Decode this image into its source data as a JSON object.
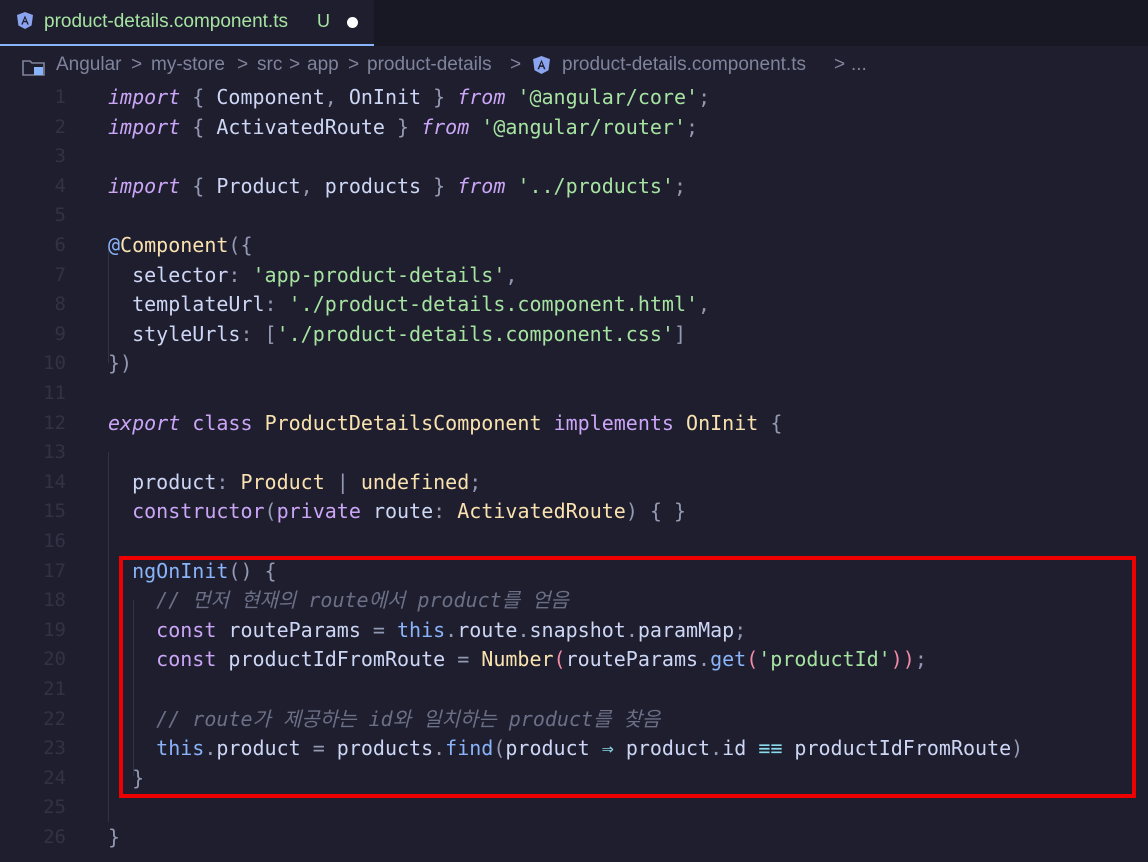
{
  "tab": {
    "title": "product-details.component.ts",
    "status": "U"
  },
  "breadcrumb": {
    "items": [
      "Angular",
      "my-store",
      "src",
      "app",
      "product-details",
      "product-details.component.ts",
      "..."
    ],
    "separator": ">"
  },
  "editor": {
    "lines": [
      {
        "n": "1",
        "tokens": [
          [
            "kw",
            "import"
          ],
          [
            "pu",
            " { "
          ],
          [
            "prop",
            "Component"
          ],
          [
            "pu",
            ", "
          ],
          [
            "prop",
            "OnInit"
          ],
          [
            "pu",
            " } "
          ],
          [
            "kw",
            "from"
          ],
          [
            "pu",
            " "
          ],
          [
            "str",
            "'@angular/core'"
          ],
          [
            "pu",
            ";"
          ]
        ]
      },
      {
        "n": "2",
        "tokens": [
          [
            "kw",
            "import"
          ],
          [
            "pu",
            " { "
          ],
          [
            "prop",
            "ActivatedRoute"
          ],
          [
            "pu",
            " } "
          ],
          [
            "kw",
            "from"
          ],
          [
            "pu",
            " "
          ],
          [
            "str",
            "'@angular/router'"
          ],
          [
            "pu",
            ";"
          ]
        ]
      },
      {
        "n": "3",
        "tokens": []
      },
      {
        "n": "4",
        "tokens": [
          [
            "kw",
            "import"
          ],
          [
            "pu",
            " { "
          ],
          [
            "prop",
            "Product"
          ],
          [
            "pu",
            ", "
          ],
          [
            "prop",
            "products"
          ],
          [
            "pu",
            " } "
          ],
          [
            "kw",
            "from"
          ],
          [
            "pu",
            " "
          ],
          [
            "str",
            "'../products'"
          ],
          [
            "pu",
            ";"
          ]
        ]
      },
      {
        "n": "5",
        "tokens": []
      },
      {
        "n": "6",
        "tokens": [
          [
            "dec",
            "@"
          ],
          [
            "ty",
            "Component"
          ],
          [
            "pu",
            "({"
          ]
        ]
      },
      {
        "n": "7",
        "tokens": [
          [
            "prop",
            "  selector"
          ],
          [
            "pu",
            ": "
          ],
          [
            "str",
            "'app-product-details'"
          ],
          [
            "pu",
            ","
          ]
        ]
      },
      {
        "n": "8",
        "tokens": [
          [
            "prop",
            "  templateUrl"
          ],
          [
            "pu",
            ": "
          ],
          [
            "str",
            "'./product-details.component.html'"
          ],
          [
            "pu",
            ","
          ]
        ]
      },
      {
        "n": "9",
        "tokens": [
          [
            "prop",
            "  styleUrls"
          ],
          [
            "pu",
            ": ["
          ],
          [
            "str",
            "'./product-details.component.css'"
          ],
          [
            "pu",
            "]"
          ]
        ]
      },
      {
        "n": "10",
        "tokens": [
          [
            "pu",
            "})"
          ]
        ]
      },
      {
        "n": "11",
        "tokens": []
      },
      {
        "n": "12",
        "tokens": [
          [
            "kw",
            "export"
          ],
          [
            "pu",
            " "
          ],
          [
            "kwn",
            "class"
          ],
          [
            "pu",
            " "
          ],
          [
            "ty",
            "ProductDetailsComponent"
          ],
          [
            "pu",
            " "
          ],
          [
            "kwn",
            "implements"
          ],
          [
            "pu",
            " "
          ],
          [
            "ty",
            "OnInit"
          ],
          [
            "pu",
            " {"
          ]
        ]
      },
      {
        "n": "13",
        "tokens": []
      },
      {
        "n": "14",
        "tokens": [
          [
            "prop",
            "  product"
          ],
          [
            "pu",
            ": "
          ],
          [
            "ty",
            "Product"
          ],
          [
            "pu",
            " | "
          ],
          [
            "ty",
            "undefined"
          ],
          [
            "pu",
            ";"
          ]
        ]
      },
      {
        "n": "15",
        "tokens": [
          [
            "kwn",
            "  constructor"
          ],
          [
            "pu",
            "("
          ],
          [
            "kwn",
            "private"
          ],
          [
            "pu",
            " "
          ],
          [
            "prop",
            "route"
          ],
          [
            "pu",
            ": "
          ],
          [
            "ty",
            "ActivatedRoute"
          ],
          [
            "pu",
            ") { }"
          ]
        ]
      },
      {
        "n": "16",
        "tokens": []
      },
      {
        "n": "17",
        "tokens": [
          [
            "fn",
            "  ngOnInit"
          ],
          [
            "pu",
            "() {"
          ]
        ]
      },
      {
        "n": "18",
        "tokens": [
          [
            "cm",
            "    // 먼저 현재의 route에서 product를 얻음"
          ]
        ]
      },
      {
        "n": "19",
        "tokens": [
          [
            "kwn",
            "    const"
          ],
          [
            "pu",
            " "
          ],
          [
            "prop",
            "routeParams"
          ],
          [
            "pu",
            " = "
          ],
          [
            "this",
            "this"
          ],
          [
            "pu",
            "."
          ],
          [
            "prop",
            "route"
          ],
          [
            "pu",
            "."
          ],
          [
            "prop",
            "snapshot"
          ],
          [
            "pu",
            "."
          ],
          [
            "prop",
            "paramMap"
          ],
          [
            "pu",
            ";"
          ]
        ]
      },
      {
        "n": "20",
        "tokens": [
          [
            "kwn",
            "    const"
          ],
          [
            "pu",
            " "
          ],
          [
            "prop",
            "productIdFromRoute"
          ],
          [
            "pu",
            " = "
          ],
          [
            "ty",
            "Number"
          ],
          [
            "br",
            "("
          ],
          [
            "prop",
            "routeParams"
          ],
          [
            "pu",
            "."
          ],
          [
            "fn",
            "get"
          ],
          [
            "br",
            "("
          ],
          [
            "str",
            "'productId'"
          ],
          [
            "br",
            "))"
          ],
          [
            "pu",
            ";"
          ]
        ]
      },
      {
        "n": "21",
        "tokens": []
      },
      {
        "n": "22",
        "tokens": [
          [
            "cm",
            "    // route가 제공하는 id와 일치하는 product를 찾음"
          ]
        ]
      },
      {
        "n": "23",
        "tokens": [
          [
            "this",
            "    this"
          ],
          [
            "pu",
            "."
          ],
          [
            "prop",
            "product"
          ],
          [
            "pu",
            " = "
          ],
          [
            "prop",
            "products"
          ],
          [
            "pu",
            "."
          ],
          [
            "fn",
            "find"
          ],
          [
            "pu",
            "("
          ],
          [
            "prop",
            "product"
          ],
          [
            "op",
            " ⇒ "
          ],
          [
            "prop",
            "product"
          ],
          [
            "pu",
            "."
          ],
          [
            "prop",
            "id"
          ],
          [
            "op",
            " ≡≡ "
          ],
          [
            "prop",
            "productIdFromRoute"
          ],
          [
            "pu",
            ")"
          ]
        ]
      },
      {
        "n": "24",
        "tokens": [
          [
            "pu",
            "  }"
          ]
        ]
      },
      {
        "n": "25",
        "tokens": []
      },
      {
        "n": "26",
        "tokens": [
          [
            "pu",
            "}"
          ]
        ]
      }
    ]
  },
  "colors": {
    "background": "#1e1e2e",
    "highlight_border": "#ee0000",
    "angular_icon": "#8aa4f0"
  },
  "icons": {
    "tab_icon": "angular-icon",
    "breadcrumb_root_icon": "folder-icon",
    "breadcrumb_file_icon": "angular-icon"
  }
}
